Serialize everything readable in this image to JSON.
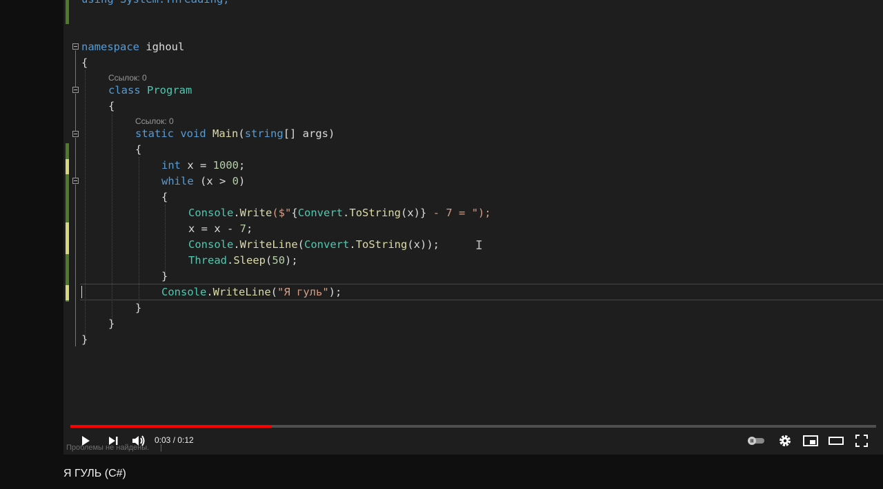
{
  "video": {
    "title": "Я ГУЛЬ (C#)",
    "current_time": "0:03",
    "time_separator": " / ",
    "duration": "0:12",
    "progress_fraction": 0.25
  },
  "editor": {
    "code": {
      "top": "using System.Threading;",
      "namespace_kw": "namespace",
      "namespace_name": "ighoul",
      "open_brace": "{",
      "close_brace": "}",
      "lens_class": "Ссылок: 0",
      "class_kw": "class",
      "class_name": "Program",
      "lens_main": "Ссылок: 0",
      "static_kw": "static",
      "void_kw": "void",
      "main_name": "Main",
      "paren_open": "(",
      "string_kw": "string",
      "args_text": "[] args)",
      "int_kw": "int",
      "x_assign": " x = ",
      "thousand": "1000",
      "semi": ";",
      "while_kw": "while",
      "while_cond": " (x > ",
      "zero": "0",
      "paren_close": ")",
      "console": "Console",
      "dot": ".",
      "write": "Write",
      "interp_open": "($\"",
      "interp_brace_open": "{",
      "convert": "Convert",
      "tostring": "ToString",
      "x_arg": "(x)",
      "interp_brace_close": "}",
      "interp_text": " - 7 = ",
      "interp_close": "\");",
      "x_minus": "x = x - ",
      "seven": "7",
      "writeline": "WriteLine",
      "writeline_close": "(x));",
      "thread": "Thread",
      "sleep": "Sleep",
      "fifty": "50",
      "str_ghoul": "\"Я гуль\"",
      "paren_semi": ");"
    }
  },
  "status": {
    "problems": "Проблемы не найдены.",
    "separator": "|"
  },
  "colors": {
    "keyword": "#569cd6",
    "type": "#4ec9b0",
    "string": "#d69d85",
    "number": "#b5cea8",
    "progress": "#ff0000"
  }
}
